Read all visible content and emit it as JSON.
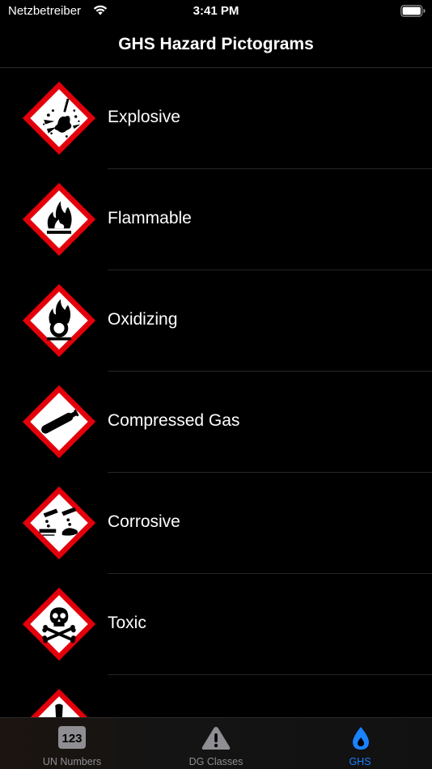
{
  "status": {
    "carrier": "Netzbetreiber",
    "time": "3:41 PM"
  },
  "nav": {
    "title": "GHS Hazard Pictograms"
  },
  "pictograms": [
    {
      "label": "Explosive",
      "icon": "explosive-pictogram"
    },
    {
      "label": "Flammable",
      "icon": "flame-pictogram"
    },
    {
      "label": "Oxidizing",
      "icon": "flame-over-circle-pictogram"
    },
    {
      "label": "Compressed Gas",
      "icon": "gas-cylinder-pictogram"
    },
    {
      "label": "Corrosive",
      "icon": "corrosion-pictogram"
    },
    {
      "label": "Toxic",
      "icon": "skull-crossbones-pictogram"
    },
    {
      "label": "",
      "icon": "exclamation-pictogram"
    }
  ],
  "tabs": [
    {
      "label": "UN Numbers",
      "icon": "123",
      "active": false
    },
    {
      "label": "DG Classes",
      "icon": "warning-triangle-icon",
      "active": false
    },
    {
      "label": "GHS",
      "icon": "drop-icon",
      "active": true
    }
  ],
  "colors": {
    "ghs_red": "#e3000b",
    "accent": "#1a82ff",
    "inactive": "#8e8e93"
  }
}
